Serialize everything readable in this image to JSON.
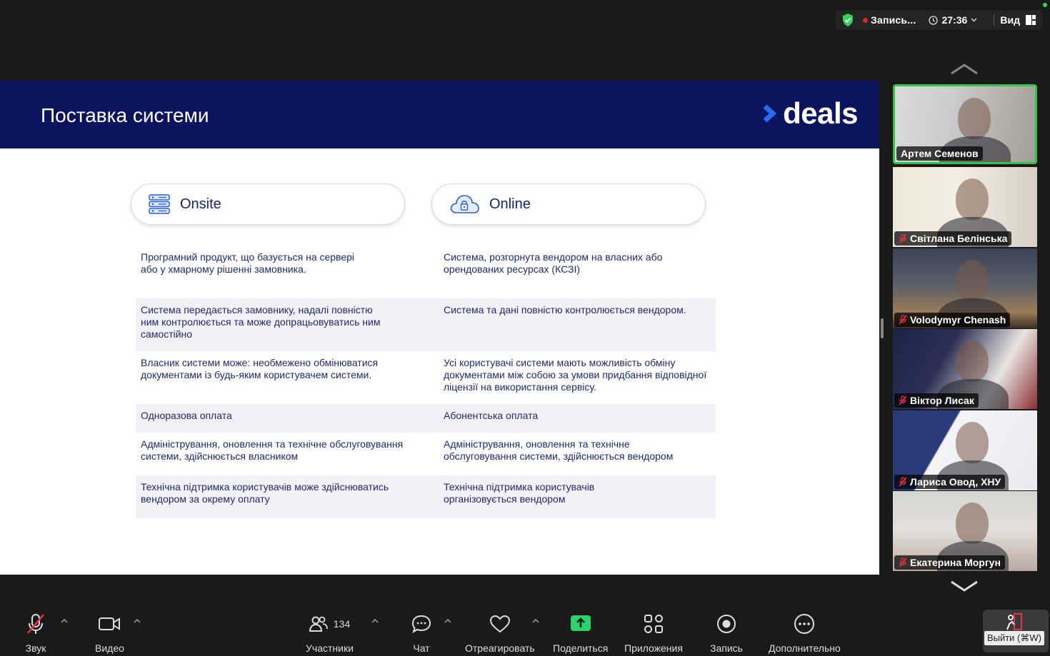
{
  "status": {
    "recording": "Запись...",
    "timer": "27:36",
    "view": "Вид"
  },
  "slide": {
    "title": "Поставка системи",
    "brand": "deals",
    "columns": [
      {
        "label": "Onsite",
        "icon": "server-stack-icon"
      },
      {
        "label": "Online",
        "icon": "cloud-lock-icon"
      }
    ],
    "rows": [
      {
        "left": "Програмний продукт, що базується на сервері\nабо у хмарному рішенні замовника.",
        "right": "Система, розгорнута вендором на власних або\nорендованих ресурсах (КСЗІ)"
      },
      {
        "left": "Система передається замовнику, надалі повністю\nним контролюється та може допрацьовуватись ним\nсамостійно",
        "right": "Система та дані повністю контролюється вендором."
      },
      {
        "left": "Власник системи може: необмежено обмінюватися\nдокументами із будь-яким користувачем системи.",
        "right": "Усі користувачі системи мають можливість обміну\nдокументами між собою за умови придбання відповідної\nліцензії на використання сервісу."
      },
      {
        "left": "Одноразова оплата",
        "right": "Абонентська оплата"
      },
      {
        "left": "Адміністрування, оновлення та технічне обслуговування\nсистеми, здійснюється власником",
        "right": "Адміністрування, оновлення та технічне\nобслуговування системи, здійснюється вендором"
      },
      {
        "left": "Технічна підтримка користувачів може здійснюватись\nвендором за окрему оплату",
        "right": "Технічна підтримка користувачів\nорганізовується вендором"
      }
    ]
  },
  "participants": [
    {
      "name": "Артем Семенов",
      "muted": false,
      "active": true
    },
    {
      "name": "Світлана Белінська",
      "muted": true
    },
    {
      "name": "Volodymyr Chenash",
      "muted": true
    },
    {
      "name": "Віктор Лисак",
      "muted": true
    },
    {
      "name": "Лариса Овод, ХНУ",
      "muted": true
    },
    {
      "name": "Екатерина Моргун",
      "muted": true
    }
  ],
  "toolbar": {
    "audio": "Звук",
    "video": "Видео",
    "participants": "Участники",
    "participants_count": "134",
    "chat": "Чат",
    "react": "Отреагировать",
    "share": "Поделиться",
    "apps": "Приложения",
    "record": "Запись",
    "more": "Дополнительно",
    "leave": "Выйти (⌘W)"
  },
  "colors": {
    "slide_header": "#0c1460",
    "accent_blue": "#1f5fe0",
    "share_green": "#2bd46b",
    "active_border": "#36c24a"
  }
}
